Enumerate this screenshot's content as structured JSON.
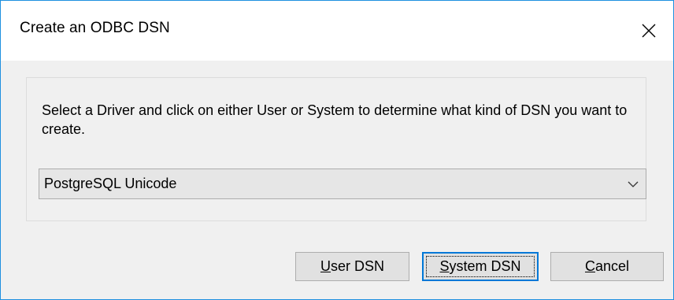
{
  "window": {
    "title": "Create an ODBC DSN"
  },
  "icons": {
    "close": "close-icon",
    "dropdown": "chevron-down-icon"
  },
  "main": {
    "instruction": "Select a Driver and click on either User or System to determine what kind of DSN you want to create.",
    "driver_select": {
      "selected": "PostgreSQL Unicode"
    }
  },
  "buttons": {
    "user_dsn": {
      "access_key": "U",
      "rest": "ser DSN"
    },
    "system_dsn": {
      "access_key": "S",
      "rest": "ystem DSN"
    },
    "cancel": {
      "access_key": "C",
      "rest": "ancel"
    }
  },
  "colors": {
    "window_border": "#1e90e0",
    "dialog_background": "#f0f0f0",
    "default_button_border": "#0078d7"
  }
}
